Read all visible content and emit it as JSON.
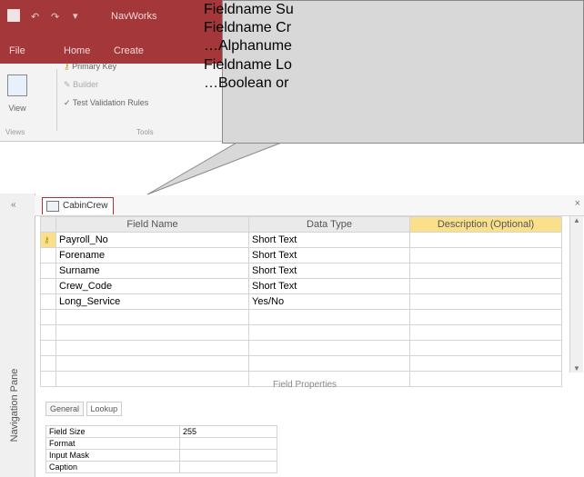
{
  "window": {
    "app_name": "NavWorks",
    "tabs": [
      "File",
      "Home",
      "Create"
    ]
  },
  "ribbon": {
    "view_label": "View",
    "primary_key": "Primary Key",
    "builder": "Builder",
    "test_validation": "Test Validation Rules",
    "group_tools": "Tools",
    "group_views": "Views"
  },
  "callout": {
    "lines": [
      "Fieldname Su",
      "Fieldname Cr",
      "…Alphanume",
      "Fieldname Lo",
      "…Boolean or"
    ]
  },
  "document": {
    "tab_label": "CabinCrew",
    "columns": [
      "Field Name",
      "Data Type",
      "Description (Optional)"
    ],
    "rows": [
      {
        "field": "Payroll_No",
        "type": "Short Text"
      },
      {
        "field": "Forename",
        "type": "Short Text"
      },
      {
        "field": "Surname",
        "type": "Short Text"
      },
      {
        "field": "Crew_Code",
        "type": "Short Text"
      },
      {
        "field": "Long_Service",
        "type": "Yes/No"
      }
    ]
  },
  "field_properties": {
    "title": "Field Properties",
    "tabs": [
      "General",
      "Lookup"
    ],
    "rows": [
      {
        "label": "Field Size",
        "value": "255"
      },
      {
        "label": "Format",
        "value": ""
      },
      {
        "label": "Input Mask",
        "value": ""
      },
      {
        "label": "Caption",
        "value": ""
      }
    ]
  },
  "nav_pane": {
    "label": "Navigation Pane"
  },
  "colors": {
    "accent": "#a4373a",
    "desc_header": "#fbe08c"
  }
}
